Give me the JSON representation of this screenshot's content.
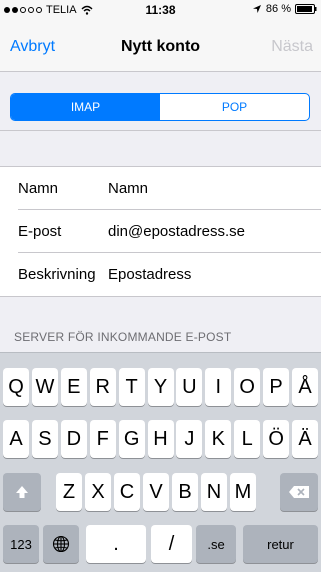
{
  "status_bar": {
    "carrier": "TELIA",
    "time": "11:38",
    "battery": "86 %"
  },
  "nav": {
    "cancel": "Avbryt",
    "title": "Nytt konto",
    "next": "Nästa"
  },
  "segment": {
    "items": [
      {
        "label": "IMAP",
        "selected": true
      },
      {
        "label": "POP",
        "selected": false
      }
    ]
  },
  "form": {
    "rows": [
      {
        "label": "Namn",
        "value": "Namn"
      },
      {
        "label": "E-post",
        "value": "din@epostadress.se"
      },
      {
        "label": "Beskrivning",
        "value": "Epostadress"
      }
    ]
  },
  "section_header": "SERVER FÖR INKOMMANDE E-POST",
  "keyboard": {
    "row1": [
      "Q",
      "W",
      "E",
      "R",
      "T",
      "Y",
      "U",
      "I",
      "O",
      "P",
      "Å"
    ],
    "row2": [
      "A",
      "S",
      "D",
      "F",
      "G",
      "H",
      "J",
      "K",
      "L",
      "Ö",
      "Ä"
    ],
    "row3": [
      "Z",
      "X",
      "C",
      "V",
      "B",
      "N",
      "M"
    ],
    "num_label": "123",
    "dot_label": ".",
    "slash_label": "/",
    "se_label": ".se",
    "return_label": "retur"
  }
}
